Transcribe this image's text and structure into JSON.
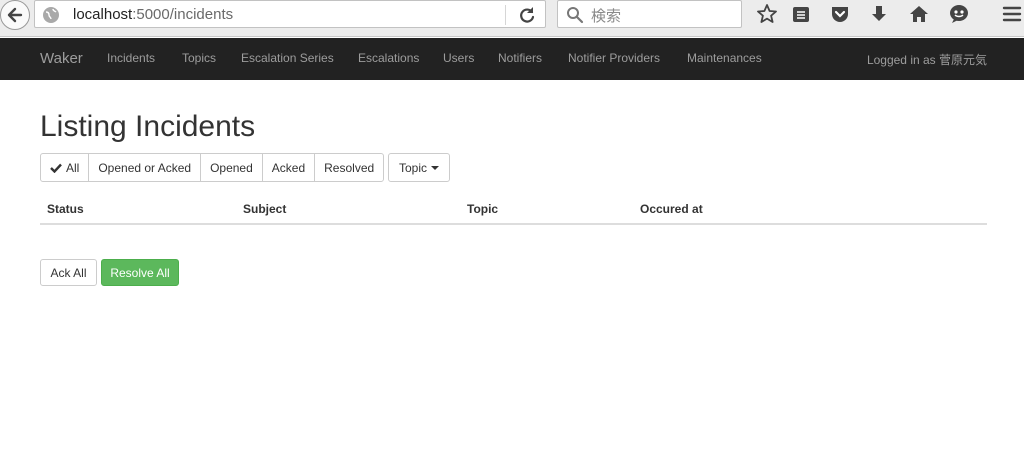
{
  "browser": {
    "url_host": "localhost",
    "url_path": ":5000/incidents",
    "search_placeholder": "検索",
    "icons": [
      "back-arrow-icon",
      "globe-icon",
      "reload-icon",
      "search-icon",
      "bookmark-star-icon",
      "reading-list-icon",
      "pocket-icon",
      "download-icon",
      "home-icon",
      "chat-icon",
      "menu-icon"
    ]
  },
  "navbar": {
    "brand": "Waker",
    "items": [
      "Incidents",
      "Topics",
      "Escalation Series",
      "Escalations",
      "Users",
      "Notifiers",
      "Notifier Providers",
      "Maintenances"
    ],
    "logged_in": "Logged in as 菅原元気"
  },
  "page": {
    "title": "Listing Incidents",
    "filters": [
      "All",
      "Opened or Acked",
      "Opened",
      "Acked",
      "Resolved"
    ],
    "active_filter": "All",
    "topic_label": "Topic",
    "table_headers": [
      "Status",
      "Subject",
      "Topic",
      "Occured at"
    ],
    "ack_all": "Ack All",
    "resolve_all": "Resolve All"
  },
  "colors": {
    "navbar_bg": "#222222",
    "nav_text": "#9d9d9d",
    "success": "#5cb85c"
  }
}
